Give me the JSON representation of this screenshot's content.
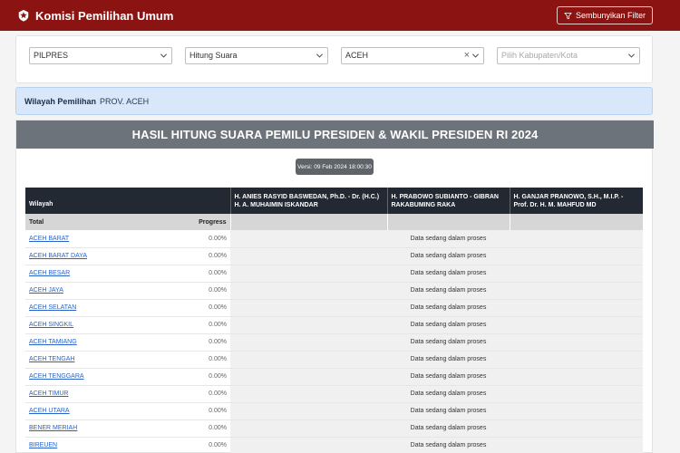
{
  "header": {
    "title": "Komisi Pemilihan Umum",
    "filter_button": "Sembunyikan Filter"
  },
  "filters": {
    "election": "PILPRES",
    "mode": "Hitung Suara",
    "province": "ACEH",
    "regency_placeholder": "Pilih Kabupaten/Kota"
  },
  "wilayah": {
    "label": "Wilayah Pemilihan",
    "value": "PROV. ACEH"
  },
  "result": {
    "title": "HASIL HITUNG SUARA PEMILU PRESIDEN & WAKIL PRESIDEN RI 2024",
    "version": "Versi: 09 Feb 2024 18:00:30"
  },
  "table": {
    "col_wilayah": "Wilayah",
    "col_progress": "Progress",
    "candidates": [
      "H. ANIES RASYID BASWEDAN, Ph.D. - Dr. (H.C.) H. A. MUHAIMIN ISKANDAR",
      "H. PRABOWO SUBIANTO - GIBRAN RAKABUMING RAKA",
      "H. GANJAR PRANOWO, S.H., M.I.P. - Prof. Dr. H. M. MAHFUD MD"
    ],
    "total_label": "Total",
    "status_text": "Data sedang dalam proses",
    "rows": [
      {
        "name": "ACEH BARAT",
        "progress": "0.00%"
      },
      {
        "name": "ACEH BARAT DAYA",
        "progress": "0.00%"
      },
      {
        "name": "ACEH BESAR",
        "progress": "0.00%"
      },
      {
        "name": "ACEH JAYA",
        "progress": "0.00%"
      },
      {
        "name": "ACEH SELATAN",
        "progress": "0.00%"
      },
      {
        "name": "ACEH SINGKIL",
        "progress": "0.00%"
      },
      {
        "name": "ACEH TAMIANG",
        "progress": "0.00%"
      },
      {
        "name": "ACEH TENGAH",
        "progress": "0.00%"
      },
      {
        "name": "ACEH TENGGARA",
        "progress": "0.00%"
      },
      {
        "name": "ACEH TIMUR",
        "progress": "0.00%"
      },
      {
        "name": "ACEH UTARA",
        "progress": "0.00%"
      },
      {
        "name": "BENER MERIAH",
        "progress": "0.00%"
      },
      {
        "name": "BIREUEN",
        "progress": "0.00%"
      }
    ]
  }
}
